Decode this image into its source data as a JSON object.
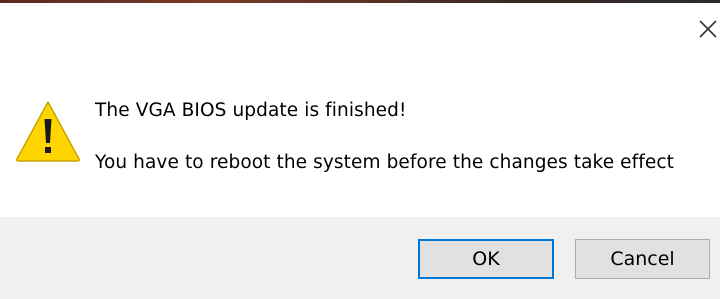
{
  "dialog": {
    "message_primary": "The VGA BIOS update is finished!",
    "message_secondary": "You have to reboot the system before the changes take effect",
    "icon": "warning-triangle-icon",
    "close_icon": "close-icon"
  },
  "buttons": {
    "ok_label": "OK",
    "cancel_label": "Cancel"
  },
  "colors": {
    "warning_fill": "#FFD700",
    "warning_stroke": "#C9A400",
    "focus_border": "#0078D7",
    "footer_bg": "#F0F0F0",
    "button_bg": "#E1E1E1"
  }
}
